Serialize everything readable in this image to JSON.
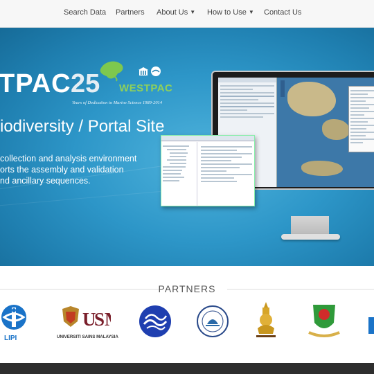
{
  "nav": {
    "search": "Search Data",
    "partners": "Partners",
    "about": "About Us",
    "howto": "How to Use",
    "contact": "Contact Us"
  },
  "hero": {
    "brand_left": "TPAC",
    "brand_number": "25",
    "brand_right": "WESTPAC",
    "tagline": "Years of Dedication to Marine Science 1989-2014",
    "title": "iodiversity / Portal Site",
    "desc_lines": [
      "collection and analysis environment",
      "orts the assembly and validation",
      "nd ancillary sequences."
    ]
  },
  "partners_section": {
    "heading": "PARTNERS",
    "logos": [
      "LIPI",
      "UNIVERSITI SAINS MALAYSIA"
    ]
  },
  "colors": {
    "hero_blue": "#2d96c8",
    "westpac_green": "#8fd15a",
    "footer": "#2e2e2e"
  }
}
